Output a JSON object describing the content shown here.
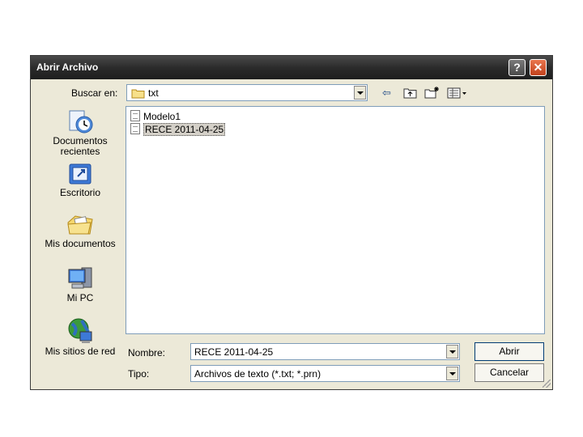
{
  "dialog": {
    "title": "Abrir Archivo",
    "help_label": "?",
    "close_label": "✕"
  },
  "lookin": {
    "label": "Buscar en:",
    "value": "txt"
  },
  "toolbar": {
    "back_icon": "⇦",
    "up_icon": "folder-up-icon",
    "new_folder_icon": "new-folder-icon",
    "views_icon": "views-menu-icon"
  },
  "places": [
    {
      "label": "Documentos recientes",
      "icon": "recent-documents-icon"
    },
    {
      "label": "Escritorio",
      "icon": "desktop-icon"
    },
    {
      "label": "Mis documentos",
      "icon": "my-documents-icon"
    },
    {
      "label": "Mi PC",
      "icon": "my-computer-icon"
    },
    {
      "label": "Mis sitios de red",
      "icon": "network-places-icon"
    }
  ],
  "files": [
    {
      "name": "Modelo1",
      "selected": false
    },
    {
      "name": "RECE 2011-04-25",
      "selected": true
    }
  ],
  "filename": {
    "label": "Nombre:",
    "value": "RECE 2011-04-25"
  },
  "filetype": {
    "label": "Tipo:",
    "value": "Archivos de texto (*.txt; *.prn)"
  },
  "buttons": {
    "open": "Abrir",
    "cancel": "Cancelar"
  }
}
